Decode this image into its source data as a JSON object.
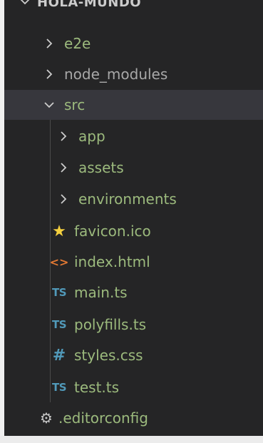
{
  "explorer": {
    "root_label": "HOLA-MUNDO",
    "items": [
      {
        "label": "e2e",
        "kind": "folder",
        "expanded": false
      },
      {
        "label": "node_modules",
        "kind": "folder",
        "expanded": false
      },
      {
        "label": "src",
        "kind": "folder",
        "expanded": true
      },
      {
        "label": "app",
        "kind": "folder",
        "expanded": false
      },
      {
        "label": "assets",
        "kind": "folder",
        "expanded": false
      },
      {
        "label": "environments",
        "kind": "folder",
        "expanded": false
      },
      {
        "label": "favicon.ico",
        "kind": "file",
        "icon": "star-icon"
      },
      {
        "label": "index.html",
        "kind": "file",
        "icon": "html-icon",
        "icon_text": "<>"
      },
      {
        "label": "main.ts",
        "kind": "file",
        "icon": "typescript-icon",
        "icon_text": "TS"
      },
      {
        "label": "polyfills.ts",
        "kind": "file",
        "icon": "typescript-icon",
        "icon_text": "TS"
      },
      {
        "label": "styles.css",
        "kind": "file",
        "icon": "css-icon",
        "icon_text": "#"
      },
      {
        "label": "test.ts",
        "kind": "file",
        "icon": "typescript-icon",
        "icon_text": "TS"
      },
      {
        "label": ".editorconfig",
        "kind": "file",
        "icon": "gear-icon"
      }
    ]
  },
  "colors": {
    "background": "#252526",
    "selected_row": "#37373d",
    "folder_text": "#9cba7d",
    "text": "#cccccc",
    "typescript": "#519aba",
    "html": "#e37933",
    "star": "#f4d03f",
    "accent": "#007acc"
  }
}
